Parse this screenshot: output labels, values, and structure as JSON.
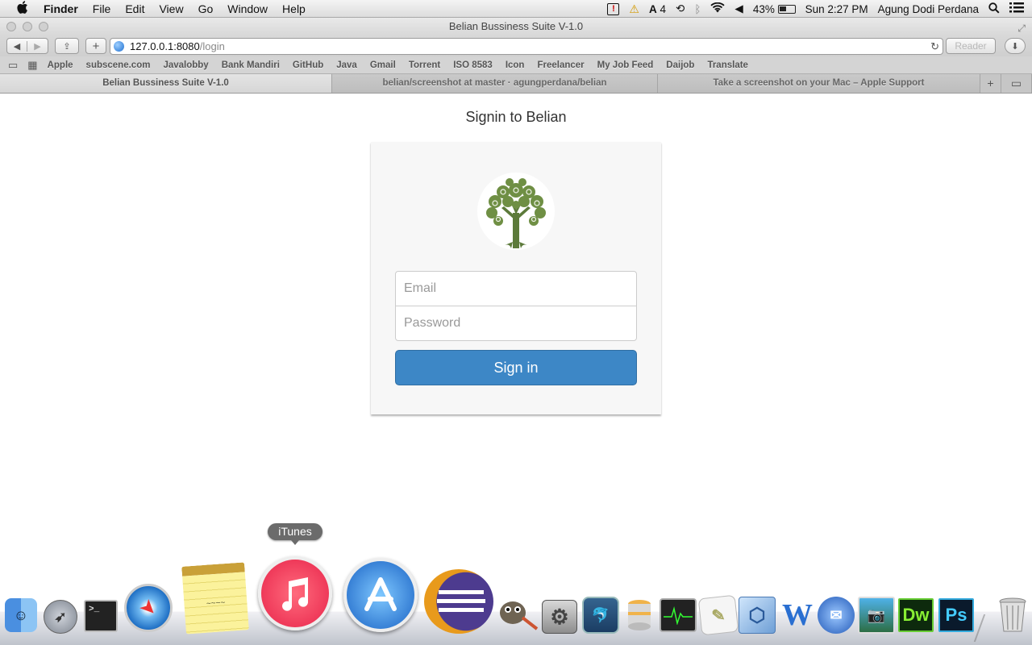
{
  "menubar": {
    "app": "Finder",
    "items": [
      "File",
      "Edit",
      "View",
      "Go",
      "Window",
      "Help"
    ],
    "status": {
      "alert": "!",
      "notifications": "4",
      "battery": "43%",
      "clock": "Sun 2:27 PM",
      "user": "Agung Dodi Perdana"
    }
  },
  "window": {
    "title": "Belian Bussiness Suite V-1.0",
    "url_host": "127.0.0.1:8080",
    "url_path": "/login",
    "reader_label": "Reader"
  },
  "bookmarks": [
    "Apple",
    "subscene.com",
    "Javalobby",
    "Bank Mandiri",
    "GitHub",
    "Java",
    "Gmail",
    "Torrent",
    "ISO 8583",
    "Icon",
    "Freelancer",
    "My Job Feed",
    "Daijob",
    "Translate"
  ],
  "tabs": [
    {
      "title": "Belian Bussiness Suite V-1.0"
    },
    {
      "title": "belian/screenshot at master · agungperdana/belian"
    },
    {
      "title": "Take a screenshot on your Mac – Apple Support"
    }
  ],
  "login": {
    "heading": "Signin to Belian",
    "email_placeholder": "Email",
    "password_placeholder": "Password",
    "submit_label": "Sign in"
  },
  "dock": {
    "tooltip": "iTunes",
    "icons": [
      "finder-icon",
      "launchpad-icon",
      "terminal-icon",
      "safari-icon",
      "notes-icon",
      "itunes-icon",
      "app-store-icon",
      "eclipse-icon",
      "gimp-icon",
      "system-preferences-icon",
      "mysql-workbench-icon",
      "sequel-pro-icon",
      "activity-monitor-icon",
      "textedit-icon",
      "virtualbox-icon",
      "word-icon",
      "thunderbird-icon",
      "iphoto-icon",
      "dreamweaver-icon",
      "photoshop-icon",
      "trash-icon"
    ],
    "labels": {
      "dreamweaver": "Dw",
      "photoshop": "Ps",
      "word": "W"
    }
  },
  "colors": {
    "primary_button": "#3d87c6",
    "card_bg": "#f7f7f7",
    "logo_green": "#5c7a3a"
  }
}
